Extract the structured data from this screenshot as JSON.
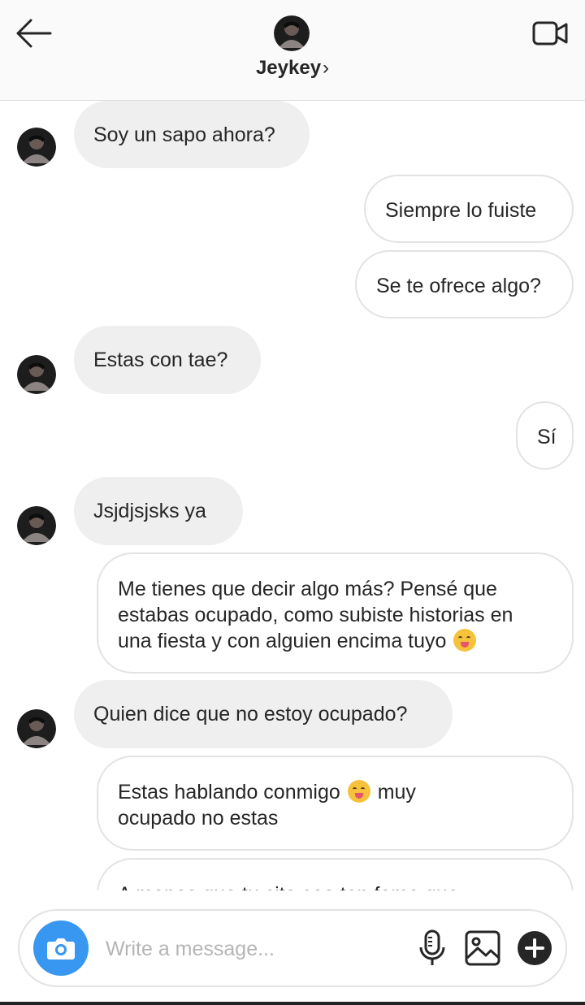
{
  "header": {
    "name": "Jeykey",
    "chevron": "›",
    "back_icon": "arrow-left-icon",
    "video_icon": "video-camera-icon"
  },
  "messages": [
    {
      "side": "in",
      "text": "Soy un sapo ahora?"
    },
    {
      "side": "out",
      "text": "Siempre lo fuiste"
    },
    {
      "side": "out",
      "text": "Se te ofrece algo?"
    },
    {
      "side": "in",
      "text": "Estas con tae?"
    },
    {
      "side": "out",
      "text": "Sí"
    },
    {
      "side": "in",
      "text": "Jsjdjsjsks ya"
    },
    {
      "side": "out",
      "lines": [
        "Me tienes que decir algo más? Pensé que",
        "estabas ocupado, como subiste historias en",
        "una fiesta y con alguien encima tuyo"
      ],
      "emoji": "face-savoring-food"
    },
    {
      "side": "in",
      "text": "Quien dice que no estoy ocupado?"
    },
    {
      "side": "out",
      "line1": "Estas hablando conmigo",
      "line1b": "muy",
      "line2": "ocupado no estas",
      "emoji": "face-savoring-food"
    },
    {
      "side": "out",
      "text": "A menos que tu cita sea tan fome que"
    }
  ],
  "composer": {
    "placeholder": "Write a message...",
    "camera_icon": "camera-icon",
    "mic_icon": "microphone-icon",
    "gallery_icon": "gallery-icon",
    "add_icon": "plus-circle-icon"
  },
  "colors": {
    "accent": "#3897f0",
    "incoming_bubble": "#efefef",
    "outgoing_border": "#e3e3e3",
    "text": "#262626"
  }
}
